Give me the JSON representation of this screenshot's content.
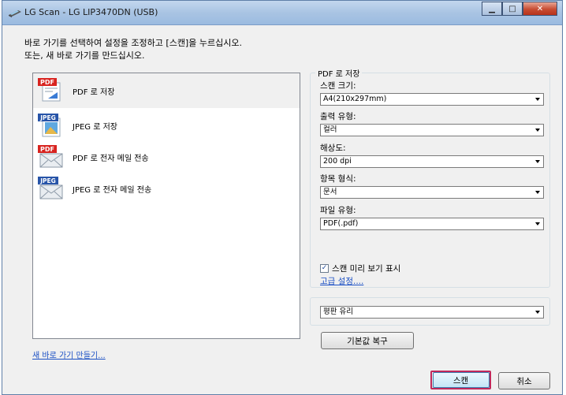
{
  "window": {
    "title": "LG Scan - LG LIP3470DN (USB)"
  },
  "instructions": {
    "line1": "바로 가기를 선택하여 설정을 조정하고 [스캔]을 누르십시오.",
    "line2": "또는, 새 바로 가기를 만드십시오."
  },
  "shortcuts": [
    {
      "label": "PDF 로 저장",
      "badge": "PDF",
      "kind": "document"
    },
    {
      "label": "JPEG 로 저장",
      "badge": "JPEG",
      "kind": "image"
    },
    {
      "label": "PDF 로 전자 메일 전송",
      "badge": "PDF",
      "kind": "envelope"
    },
    {
      "label": "JPEG 로 전자 메일 전송",
      "badge": "JPEG",
      "kind": "envelope"
    }
  ],
  "new_shortcut_link": "새 바로 가기 만들기...",
  "settings": {
    "group_title": "PDF 로 저장",
    "scan_size_label": "스캔 크기:",
    "scan_size_value": "A4(210x297mm)",
    "output_type_label": "출력 유형:",
    "output_type_value": "컬러",
    "resolution_label": "해상도:",
    "resolution_value": "200 dpi",
    "item_format_label": "항목 형식:",
    "item_format_value": "문서",
    "file_type_label": "파일 유형:",
    "file_type_value": "PDF(.pdf)",
    "preview_label": "스캔 미리 보기 표시",
    "preview_checked": true,
    "advanced_link": "고급 설정...."
  },
  "source": {
    "value": "평판 유리"
  },
  "buttons": {
    "reset": "기본값 복구",
    "scan": "스캔",
    "cancel": "취소"
  },
  "colors": {
    "pdf_badge": "#d8231f",
    "jpeg_badge": "#2754a8",
    "highlight_border": "#c0285b",
    "link": "#1a4fc4"
  }
}
